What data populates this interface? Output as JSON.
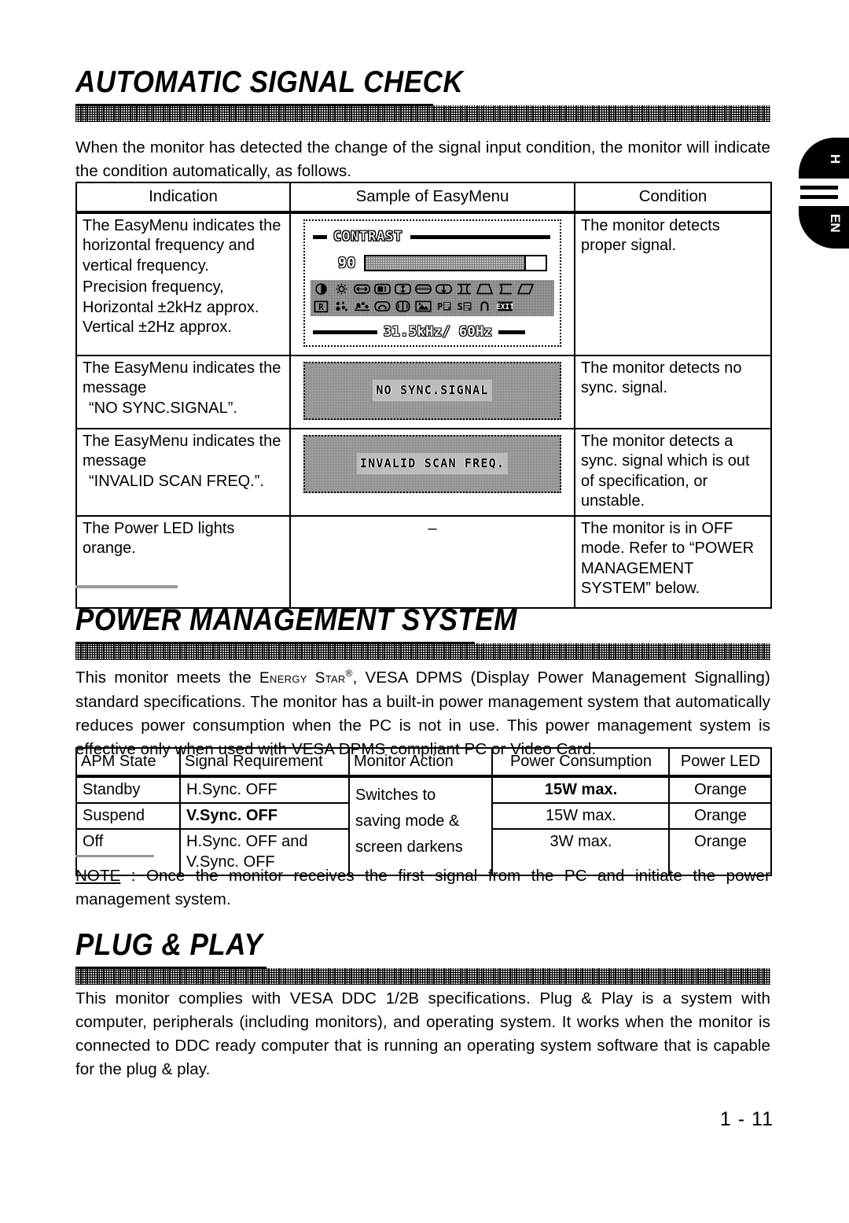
{
  "sections": {
    "signal_check": {
      "heading": "AUTOMATIC SIGNAL CHECK",
      "intro": "When the monitor has detected the change of the signal input condition, the monitor will indicate the condition automatically, as follows.",
      "table": {
        "headers": [
          "Indication",
          "Sample of EasyMenu",
          "Condition"
        ],
        "rows": [
          {
            "indication_line1": "The EasyMenu indicates the horizontal frequency and vertical frequency.",
            "indication_line2": "Precision frequency, Horizontal ±2kHz approx.",
            "indication_line3": "Vertical ±2Hz approx.",
            "sample_type": "osd-menu",
            "condition": "The monitor detects proper signal."
          },
          {
            "indication_line1": "The EasyMenu indicates the message",
            "indication_line2": "“NO SYNC.SIGNAL”.",
            "sample_type": "osd-message",
            "sample_text": "NO SYNC.SIGNAL",
            "condition": "The monitor detects no sync. signal."
          },
          {
            "indication_line1": "The EasyMenu indicates the message",
            "indication_line2": "“INVALID SCAN FREQ.”.",
            "sample_type": "osd-message",
            "sample_text": "INVALID SCAN FREQ.",
            "condition": "The monitor detects a sync. signal which is out of specification, or unstable."
          },
          {
            "indication_line1": "The Power LED lights orange.",
            "sample_type": "dash",
            "sample_text": "–",
            "condition": "The monitor is in OFF mode. Refer to “POWER MANAGEMENT SYSTEM” below."
          }
        ]
      },
      "osd_sample": {
        "label": "CONTRAST",
        "value": "90",
        "frequency": "31.5kHz/ 60Hz",
        "slider_fill_percent": 88,
        "icons_row1": [
          "contrast-icon",
          "brightness-icon",
          "h-size-icon",
          "h-position-icon",
          "v-size-icon",
          "v-position-icon",
          "v-shift-icon",
          "pincushion-icon",
          "trapezoid-icon",
          "pin-balance-icon",
          "parallelogram-icon"
        ],
        "icons_row2": [
          "rotation-icon",
          "convergence-icon",
          "moire-icon",
          "degauss-icon",
          "color-temp-icon",
          "language-icon",
          "osd-position-icon",
          "self-test-icon",
          "recall-icon",
          "exit-icon"
        ]
      }
    },
    "power_management": {
      "heading": "POWER MANAGEMENT SYSTEM",
      "intro_part1": "This monitor meets the ",
      "intro_energy": "Energy Star",
      "intro_reg": "®",
      "intro_part2": ", VESA DPMS (Display Power Management Signalling) standard specifications.   The monitor has a built-in power management system that automatically reduces power consumption when the PC is not in use.   This power management system is effective only when used with VESA DPMS compliant PC or Video Card.",
      "table": {
        "headers": [
          "APM  State",
          "Signal  Requirement",
          "Monitor  Action",
          "Power Consumption",
          "Power LED"
        ],
        "rows": [
          {
            "apm_state": "Standby",
            "signal": "H.Sync.  OFF",
            "power": "15W max.",
            "led": "Orange"
          },
          {
            "apm_state": "Suspend",
            "signal": "V.Sync. OFF",
            "power": "15W  max.",
            "led": "Orange"
          },
          {
            "apm_state": "Off",
            "signal": "H.Sync.  OFF  and\nV.Sync. OFF",
            "power": "3W  max.",
            "led": "Orange"
          }
        ],
        "monitor_action": "Switches to\nsaving mode &\nscreen darkens"
      },
      "note_label": "NOTE",
      "note_text": " : Once the monitor receives the first signal from the PC and initiate the power management  system."
    },
    "plug_play": {
      "heading": "PLUG & PLAY",
      "body": "This monitor complies with VESA DDC 1/2B specifications.   Plug & Play is a system with computer, peripherals (including monitors), and operating system.   It works when the monitor is connected to DDC ready computer that is running an operating system software that is capable for the plug & play."
    }
  },
  "tab_marker": {
    "label_top": "H",
    "label_bottom": "EN"
  },
  "footer": {
    "page_number": "1 - 11"
  },
  "colors": {
    "ink": "#000000",
    "paper": "#ffffff",
    "halftone": "#bfbfbf"
  }
}
